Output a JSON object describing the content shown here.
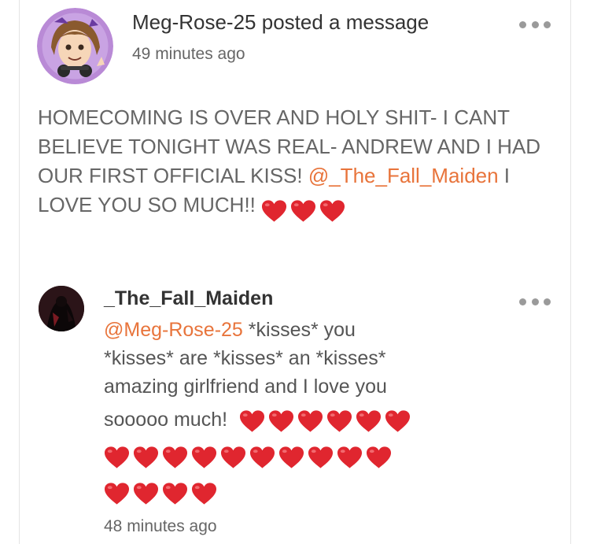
{
  "post": {
    "author": "Meg-Rose-25",
    "action": "posted a message",
    "time": "49 minutes ago",
    "text_before_mention": "HOMECOMING IS OVER AND HOLY SHIT- I CANT BELIEVE TONIGHT WAS REAL- ANDREW AND I HAD OUR FIRST OFFICIAL KISS! ",
    "mention": "@_The_Fall_Maiden",
    "text_after_mention": " I LOVE YOU SO MUCH!! ",
    "heart_count": 3,
    "more_icon": "more-horizontal-icon"
  },
  "comment": {
    "author": "_The_Fall_Maiden",
    "mention": "@Meg-Rose-25",
    "text_line1_rest": " *kisses* you",
    "text_line2": "*kisses* are *kisses* an *kisses*",
    "text_line3": "amazing girlfriend and I love you",
    "text_line4": "sooooo much!",
    "heart_rows": [
      6,
      10,
      4
    ],
    "time": "48 minutes ago",
    "more_icon": "more-horizontal-icon"
  },
  "colors": {
    "mention": "#e8743b",
    "heart": "#e0262f",
    "dots": "#9a9a9a",
    "text": "#666666"
  }
}
